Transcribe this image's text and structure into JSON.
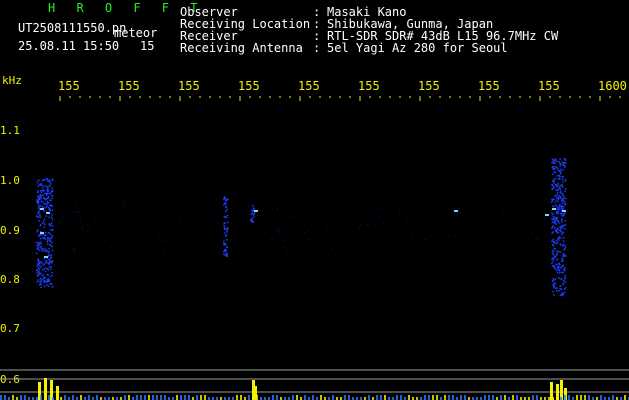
{
  "header": {
    "title": "H R O F F T",
    "filename": "UT2508111550.pn",
    "mode": "meteor",
    "datetime": "25.08.11 15:50",
    "count": "15",
    "labels": [
      "Observer",
      "Receiving Location",
      "Receiver",
      "Receiving Antenna"
    ],
    "colons": [
      ":",
      ":",
      ":",
      ":"
    ],
    "values": [
      "Masaki Kano",
      "Shibukawa, Gunma, Japan",
      "RTL-SDR SDR# 43dB L15 96.7MHz CW",
      "5el Yagi Az 280 for Seoul"
    ]
  },
  "freq_axis": {
    "unit": "kHz",
    "ticks": [
      "155",
      "155",
      "155",
      "155",
      "155",
      "155",
      "155",
      "155",
      "155",
      "1600"
    ]
  },
  "y_axis": {
    "ticks": [
      "1.1",
      "1.0",
      "0.9",
      "0.8",
      "0.7",
      "0.6"
    ]
  },
  "colors": {
    "background": "#000000",
    "title": "#22ee22",
    "text": "#ffffff",
    "axis": "#f2f200",
    "spectrum": "#1f3cff",
    "spectrum_bright": "#7fd4ff",
    "histogram": "#f2f200"
  },
  "spectrogram": {
    "type": "spectrogram",
    "events": [
      {
        "x": "155",
        "band": "0.8-1.0"
      },
      {
        "x": "155",
        "band": "0.9-1.0"
      },
      {
        "x": "155",
        "band": "0.8-1.0"
      }
    ]
  }
}
